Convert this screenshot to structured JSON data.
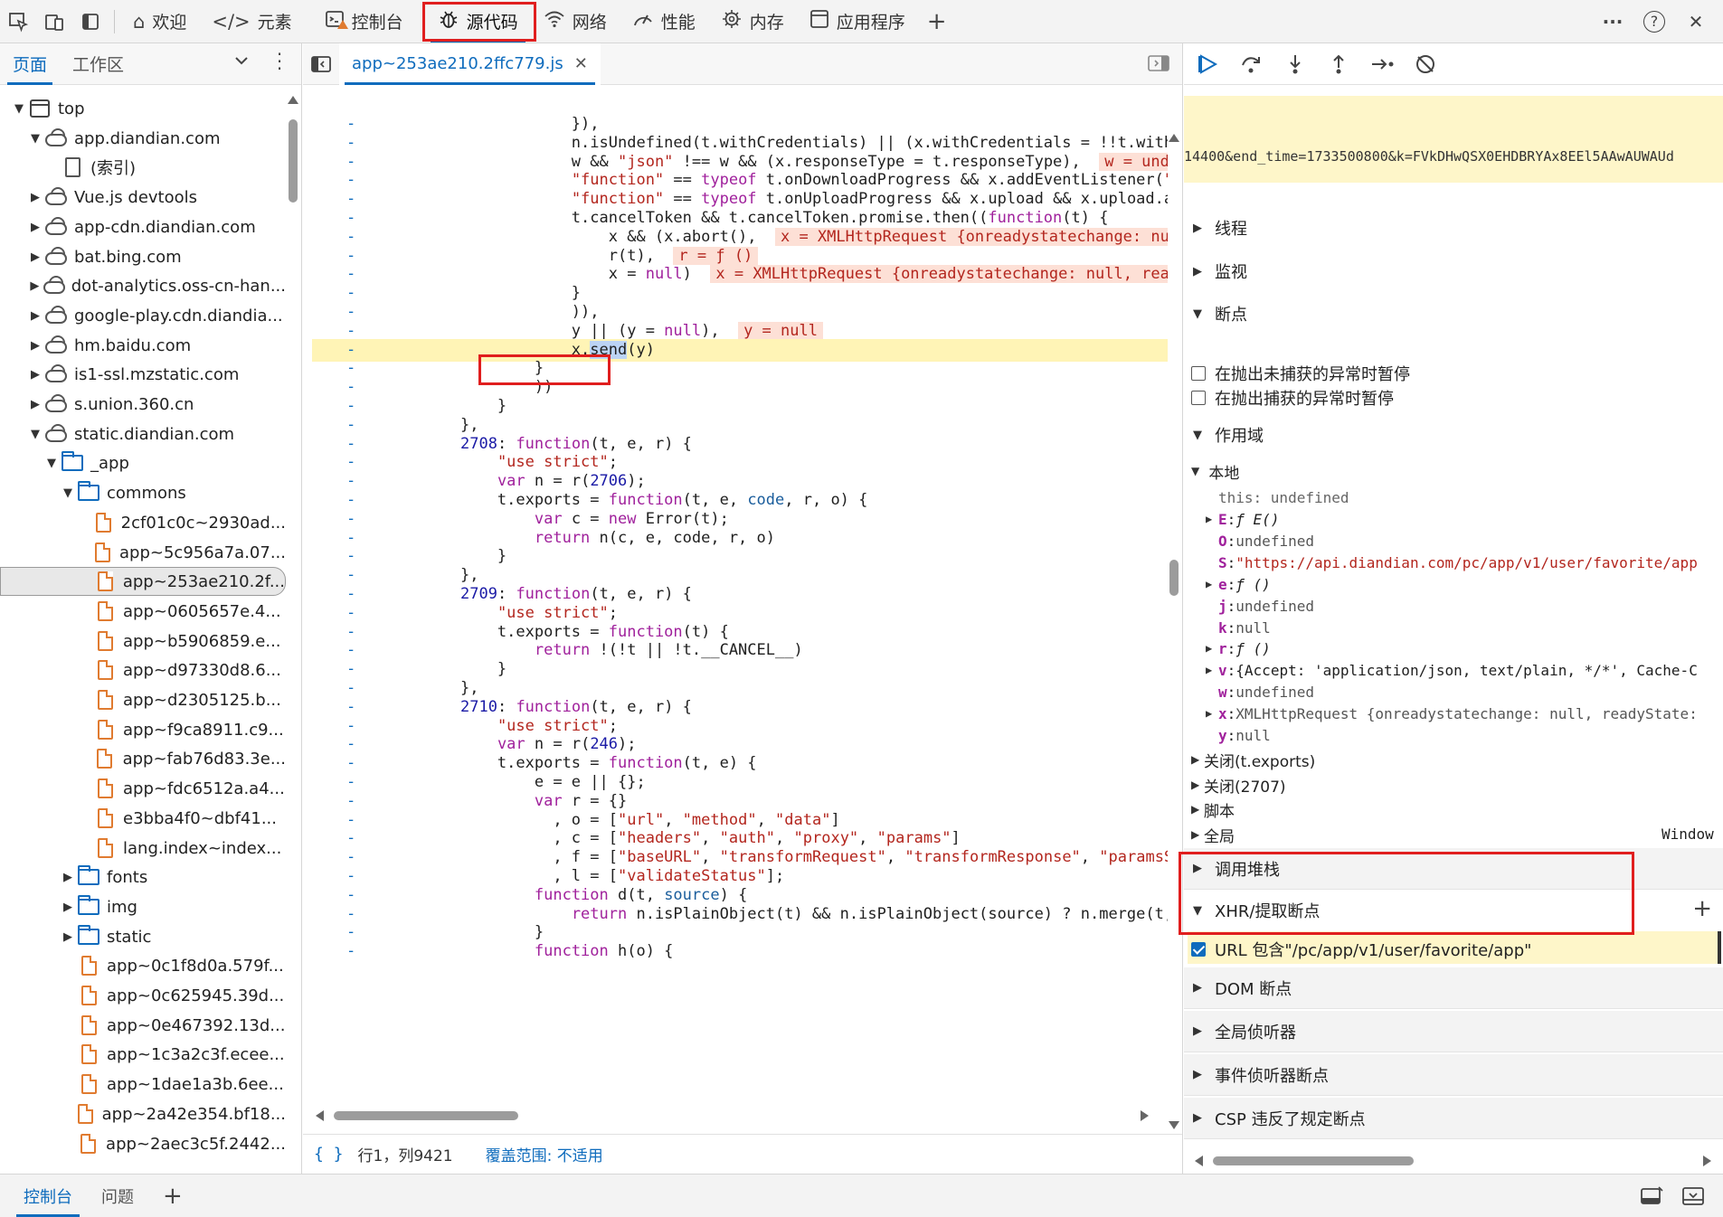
{
  "topbar": {
    "tabs": [
      {
        "label": "欢迎",
        "icon": "home-icon"
      },
      {
        "label": "元素",
        "icon": "code-brackets-icon"
      },
      {
        "label": "控制台",
        "icon": "console-icon"
      },
      {
        "label": "源代码",
        "icon": "bug-icon",
        "active": true
      },
      {
        "label": "网络",
        "icon": "wifi-icon"
      },
      {
        "label": "性能",
        "icon": "performance-icon"
      },
      {
        "label": "内存",
        "icon": "memory-chip-icon"
      },
      {
        "label": "应用程序",
        "icon": "app-window-icon"
      }
    ],
    "add": "+",
    "more": "···",
    "help": "?",
    "close": "✕"
  },
  "nav": {
    "tabs": [
      "页面",
      "工作区"
    ],
    "tree": [
      {
        "depth": 0,
        "arrow": "down",
        "icon": "frame",
        "label": "top"
      },
      {
        "depth": 1,
        "arrow": "down",
        "icon": "cloud",
        "label": "app.diandian.com"
      },
      {
        "depth": 2,
        "arrow": "",
        "icon": "page",
        "label": "(索引)"
      },
      {
        "depth": 1,
        "arrow": "right",
        "icon": "cloud",
        "label": "Vue.js devtools"
      },
      {
        "depth": 1,
        "arrow": "right",
        "icon": "cloud",
        "label": "app-cdn.diandian.com"
      },
      {
        "depth": 1,
        "arrow": "right",
        "icon": "cloud",
        "label": "bat.bing.com"
      },
      {
        "depth": 1,
        "arrow": "right",
        "icon": "cloud",
        "label": "dot-analytics.oss-cn-han..."
      },
      {
        "depth": 1,
        "arrow": "right",
        "icon": "cloud",
        "label": "google-play.cdn.diandia..."
      },
      {
        "depth": 1,
        "arrow": "right",
        "icon": "cloud",
        "label": "hm.baidu.com"
      },
      {
        "depth": 1,
        "arrow": "right",
        "icon": "cloud",
        "label": "is1-ssl.mzstatic.com"
      },
      {
        "depth": 1,
        "arrow": "right",
        "icon": "cloud",
        "label": "s.union.360.cn"
      },
      {
        "depth": 1,
        "arrow": "down",
        "icon": "cloud",
        "label": "static.diandian.com"
      },
      {
        "depth": 2,
        "arrow": "down",
        "icon": "folder",
        "label": "_app"
      },
      {
        "depth": 3,
        "arrow": "down",
        "icon": "folder",
        "label": "commons"
      },
      {
        "depth": 4,
        "arrow": "",
        "icon": "file",
        "label": "2cf01c0c~2930ad..."
      },
      {
        "depth": 4,
        "arrow": "",
        "icon": "file",
        "label": "app~5c956a7a.07..."
      },
      {
        "depth": 4,
        "arrow": "",
        "icon": "file",
        "label": "app~253ae210.2f...",
        "selected": true
      },
      {
        "depth": 4,
        "arrow": "",
        "icon": "file",
        "label": "app~0605657e.4..."
      },
      {
        "depth": 4,
        "arrow": "",
        "icon": "file",
        "label": "app~b5906859.e..."
      },
      {
        "depth": 4,
        "arrow": "",
        "icon": "file",
        "label": "app~d97330d8.6..."
      },
      {
        "depth": 4,
        "arrow": "",
        "icon": "file",
        "label": "app~d2305125.b..."
      },
      {
        "depth": 4,
        "arrow": "",
        "icon": "file",
        "label": "app~f9ca8911.c9..."
      },
      {
        "depth": 4,
        "arrow": "",
        "icon": "file",
        "label": "app~fab76d83.3e..."
      },
      {
        "depth": 4,
        "arrow": "",
        "icon": "file",
        "label": "app~fdc6512a.a4..."
      },
      {
        "depth": 4,
        "arrow": "",
        "icon": "file",
        "label": "e3bba4f0~dbf41..."
      },
      {
        "depth": 4,
        "arrow": "",
        "icon": "file",
        "label": "lang.index~index..."
      },
      {
        "depth": 3,
        "arrow": "right",
        "icon": "folder",
        "label": "fonts"
      },
      {
        "depth": 3,
        "arrow": "right",
        "icon": "folder",
        "label": "img"
      },
      {
        "depth": 3,
        "arrow": "right",
        "icon": "folder",
        "label": "static"
      },
      {
        "depth": 3,
        "arrow": "",
        "icon": "file",
        "label": "app~0c1f8d0a.579f..."
      },
      {
        "depth": 3,
        "arrow": "",
        "icon": "file",
        "label": "app~0c625945.39d..."
      },
      {
        "depth": 3,
        "arrow": "",
        "icon": "file",
        "label": "app~0e467392.13d..."
      },
      {
        "depth": 3,
        "arrow": "",
        "icon": "file",
        "label": "app~1c3a2c3f.ecee..."
      },
      {
        "depth": 3,
        "arrow": "",
        "icon": "file",
        "label": "app~1dae1a3b.6ee..."
      },
      {
        "depth": 3,
        "arrow": "",
        "icon": "file",
        "label": "app~2a42e354.bf18..."
      },
      {
        "depth": 3,
        "arrow": "",
        "icon": "file",
        "label": "app~2aec3c5f.2442..."
      }
    ]
  },
  "editor": {
    "tab_label": "app~253ae210.2ffc779.js",
    "lines": [
      {
        "i": 0,
        "html": "                    }),"
      },
      {
        "i": 0,
        "html": "                    n.isUndefined(t.withCredentials) || (x.withCredentials = !!t.withCreden"
      },
      {
        "i": 0,
        "html": "                    w &amp;&amp; <span class=\"str\">\"json\"</span> !== w &amp;&amp; (x.responseType = t.responseType),  <span class=\"inl\">w = undefined</span>"
      },
      {
        "i": 0,
        "html": "                    <span class=\"str\">\"function\"</span> == <span class=\"kw\">typeof</span> t.onDownloadProgress &amp;&amp; x.addEventListener(<span class=\"str\">\"progre</span>"
      },
      {
        "i": 0,
        "html": "                    <span class=\"str\">\"function\"</span> == <span class=\"kw\">typeof</span> t.onUploadProgress &amp;&amp; x.upload &amp;&amp; x.upload.addEven"
      },
      {
        "i": 0,
        "html": "                    t.cancelToken &amp;&amp; t.cancelToken.promise.then((<span class=\"kw\">function</span>(t) {"
      },
      {
        "i": 0,
        "html": "                        x &amp;&amp; (x.abort(),  <span class=\"inl\">x = XMLHttpRequest {onreadystatechange: null, rea</span>"
      },
      {
        "i": 0,
        "html": "                        r(t),  <span class=\"inl\">r = ƒ ()</span>"
      },
      {
        "i": 0,
        "html": "                        x = <span class=\"kw\">null</span>)  <span class=\"inl\">x = XMLHttpRequest {onreadystatechange: null, readyState</span>"
      },
      {
        "i": 0,
        "html": "                    }"
      },
      {
        "i": 0,
        "html": "                    )),"
      },
      {
        "i": 0,
        "html": "                    y || (y = <span class=\"kw\">null</span>),  <span class=\"inl\">y = null</span>"
      },
      {
        "i": 0,
        "html": "                    x.<span class=\"sel\">send</span>(y)",
        "hl": true
      },
      {
        "i": 0,
        "html": "                }"
      },
      {
        "i": 0,
        "html": "                ))"
      },
      {
        "i": 0,
        "html": "            }"
      },
      {
        "i": 0,
        "html": "        },"
      },
      {
        "i": 0,
        "html": "        <span class=\"num\">2708</span>: <span class=\"kw\">function</span>(t, e, r) {"
      },
      {
        "i": 0,
        "html": "            <span class=\"str\">\"use strict\"</span>;"
      },
      {
        "i": 0,
        "html": "            <span class=\"kw\">var</span> n = r(<span class=\"num\">2706</span>);"
      },
      {
        "i": 0,
        "html": "            t.exports = <span class=\"kw\">function</span>(t, e, <span class=\"param\">code</span>, r, o) {"
      },
      {
        "i": 0,
        "html": "                <span class=\"kw\">var</span> c = <span class=\"kw\">new</span> Error(t);"
      },
      {
        "i": 0,
        "html": "                <span class=\"kw\">return</span> n(c, e, code, r, o)"
      },
      {
        "i": 0,
        "html": "            }"
      },
      {
        "i": 0,
        "html": "        },"
      },
      {
        "i": 0,
        "html": "        <span class=\"num\">2709</span>: <span class=\"kw\">function</span>(t, e, r) {"
      },
      {
        "i": 0,
        "html": "            <span class=\"str\">\"use strict\"</span>;"
      },
      {
        "i": 0,
        "html": "            t.exports = <span class=\"kw\">function</span>(t) {"
      },
      {
        "i": 0,
        "html": "                <span class=\"kw\">return</span> !(!t || !t.__CANCEL__)"
      },
      {
        "i": 0,
        "html": "            }"
      },
      {
        "i": 0,
        "html": "        },"
      },
      {
        "i": 0,
        "html": "        <span class=\"num\">2710</span>: <span class=\"kw\">function</span>(t, e, r) {"
      },
      {
        "i": 0,
        "html": "            <span class=\"str\">\"use strict\"</span>;"
      },
      {
        "i": 0,
        "html": "            <span class=\"kw\">var</span> n = r(<span class=\"num\">246</span>);"
      },
      {
        "i": 0,
        "html": "            t.exports = <span class=\"kw\">function</span>(t, e) {"
      },
      {
        "i": 0,
        "html": "                e = e || {};"
      },
      {
        "i": 0,
        "html": "                <span class=\"kw\">var</span> r = {}"
      },
      {
        "i": 0,
        "html": "                  , o = [<span class=\"str\">\"url\"</span>, <span class=\"str\">\"method\"</span>, <span class=\"str\">\"data\"</span>]"
      },
      {
        "i": 0,
        "html": "                  , c = [<span class=\"str\">\"headers\"</span>, <span class=\"str\">\"auth\"</span>, <span class=\"str\">\"proxy\"</span>, <span class=\"str\">\"params\"</span>]"
      },
      {
        "i": 0,
        "html": "                  , f = [<span class=\"str\">\"baseURL\"</span>, <span class=\"str\">\"transformRequest\"</span>, <span class=\"str\">\"transformResponse\"</span>, <span class=\"str\">\"paramsSeriali</span>"
      },
      {
        "i": 0,
        "html": "                  , l = [<span class=\"str\">\"validateStatus\"</span>];"
      },
      {
        "i": 0,
        "html": "                <span class=\"kw\">function</span> d(t, <span class=\"param\">source</span>) {"
      },
      {
        "i": 0,
        "html": "                    <span class=\"kw\">return</span> n.isPlainObject(t) &amp;&amp; n.isPlainObject(source) ? n.merge(t, sourc"
      },
      {
        "i": 0,
        "html": "                }"
      },
      {
        "i": 0,
        "html": "                <span class=\"kw\">function</span> h(o) {"
      }
    ],
    "status": {
      "braces": "{ }",
      "position": "行1，列9421",
      "coverage": "覆盖范围: 不适用"
    }
  },
  "debugger": {
    "pause_url": "14400&end_time=1733500800&k=FVkDHwQSX0EHDBRYAx8EEl5AAwAUWAUd",
    "sections": {
      "threads": "线程",
      "watch": "监视",
      "breakpoints": "断点",
      "scope": "作用域",
      "call_stack": "调用堆栈",
      "xhr": "XHR/提取断点",
      "dom": "DOM 断点",
      "global_listeners": "全局侦听器",
      "event_listeners": "事件侦听器断点",
      "csp": "CSP 违反了规定断点"
    },
    "bp_options": [
      "在抛出未捕获的异常时暂停",
      "在抛出捕获的异常时暂停"
    ],
    "scope": {
      "local": "本地",
      "this_key": "this",
      "this_val": "undefined",
      "vars": [
        {
          "tri": true,
          "key": "E",
          "val": "ƒ E()",
          "kind": "fn"
        },
        {
          "tri": false,
          "key": "O",
          "val": "undefined",
          "kind": "gray"
        },
        {
          "tri": false,
          "key": "S",
          "val": "\"https://api.diandian.com/pc/app/v1/user/favorite/app",
          "kind": "str"
        },
        {
          "tri": true,
          "key": "e",
          "val": "ƒ ()",
          "kind": "fn"
        },
        {
          "tri": false,
          "key": "j",
          "val": "undefined",
          "kind": "gray"
        },
        {
          "tri": false,
          "key": "k",
          "val": "null",
          "kind": "gray"
        },
        {
          "tri": true,
          "key": "r",
          "val": "ƒ ()",
          "kind": "fn"
        },
        {
          "tri": true,
          "key": "v",
          "val": "{Accept: 'application/json, text/plain, */*', Cache-C",
          "kind": "obj"
        },
        {
          "tri": false,
          "key": "w",
          "val": "undefined",
          "kind": "gray"
        },
        {
          "tri": true,
          "key": "x",
          "val": "XMLHttpRequest {onreadystatechange: null, readyState:",
          "kind": "xhr"
        },
        {
          "tri": false,
          "key": "y",
          "val": "null",
          "kind": "gray"
        }
      ],
      "closures": [
        "关闭(t.exports)",
        "关闭(2707)",
        "脚本",
        "全局"
      ],
      "global_val": "Window"
    },
    "xhr_bp": {
      "label": "URL 包含\"/pc/app/v1/user/favorite/app\"",
      "checked": true
    },
    "add": "+"
  },
  "bottom": {
    "tabs": [
      "控制台",
      "问题"
    ],
    "add": "+"
  }
}
